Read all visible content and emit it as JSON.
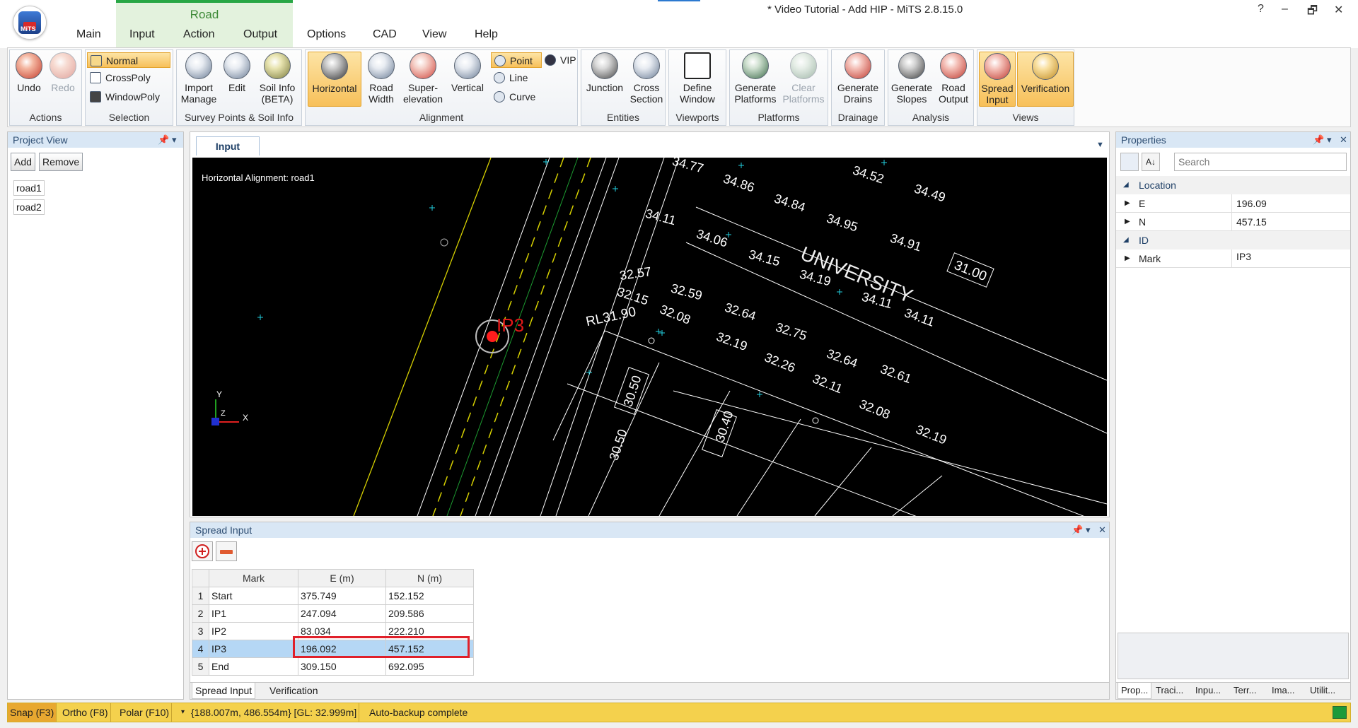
{
  "window": {
    "title": "* Video Tutorial - Add HIP - MiTS 2.8.15.0",
    "help": "?",
    "minimize": "–",
    "restore": "🗗",
    "close": "✕"
  },
  "tabs": {
    "context": "Road",
    "items": [
      "Main",
      "Input",
      "Action",
      "Output",
      "Options",
      "CAD",
      "View",
      "Help"
    ]
  },
  "ribbon": {
    "actions": {
      "label": "Actions",
      "undo": "Undo",
      "redo": "Redo"
    },
    "selection": {
      "label": "Selection",
      "normal": "Normal",
      "crosspoly": "CrossPoly",
      "windowpoly": "WindowPoly"
    },
    "survey": {
      "label": "Survey Points & Soil Info",
      "import_l1": "Import",
      "import_l2": "Manage",
      "edit": "Edit",
      "soil_l1": "Soil Info",
      "soil_l2": "(BETA)"
    },
    "alignment": {
      "label": "Alignment",
      "horizontal": "Horizontal",
      "roadwidth_l1": "Road",
      "roadwidth_l2": "Width",
      "super_l1": "Super-",
      "super_l2": "elevation",
      "vertical": "Vertical",
      "point": "Point",
      "line": "Line",
      "curve": "Curve",
      "vip": "VIP"
    },
    "entities": {
      "label": "Entities",
      "junction": "Junction",
      "cross_l1": "Cross",
      "cross_l2": "Section"
    },
    "viewports": {
      "label": "Viewports",
      "define_l1": "Define",
      "define_l2": "Window"
    },
    "platforms": {
      "label": "Platforms",
      "gen_l1": "Generate",
      "gen_l2": "Platforms",
      "clear_l1": "Clear",
      "clear_l2": "Platforms"
    },
    "drainage": {
      "label": "Drainage",
      "gen_l1": "Generate",
      "gen_l2": "Drains"
    },
    "analysis": {
      "label": "Analysis",
      "slopes_l1": "Generate",
      "slopes_l2": "Slopes",
      "road_l1": "Road",
      "road_l2": "Output"
    },
    "views": {
      "label": "Views",
      "spread_l1": "Spread",
      "spread_l2": "Input",
      "verification": "Verification"
    }
  },
  "project": {
    "title": "Project View",
    "add": "Add",
    "remove": "Remove",
    "items": [
      "road1",
      "road2"
    ]
  },
  "document": {
    "tab": "Input",
    "canvas_title": "Horizontal Alignment: road1",
    "axis_y": "Y",
    "axis_x": "X",
    "axis_z": "Z",
    "ip_label": "IP3",
    "rl_label": "RL31.90",
    "university": "UNIVERSITY",
    "lot_label": "31.00",
    "spot_levels": [
      "34.77",
      "34.86",
      "34.84",
      "34.52",
      "34.49",
      "34.11",
      "34.06",
      "34.95",
      "34.91",
      "34.15",
      "32.57",
      "32.59",
      "34.19",
      "34.11",
      "32.15",
      "32.08",
      "32.64",
      "32.75",
      "34.11",
      "32.19",
      "32.64",
      "32.26",
      "32.61",
      "32.11",
      "32.08",
      "32.19",
      "30.50",
      "30.40",
      "30.50"
    ]
  },
  "spread": {
    "title": "Spread Input",
    "headers": [
      "Mark",
      "E (m)",
      "N (m)"
    ],
    "rows": [
      [
        "1",
        "Start",
        "375.749",
        "152.152"
      ],
      [
        "2",
        "IP1",
        "247.094",
        "209.586"
      ],
      [
        "3",
        "IP2",
        "83.034",
        "222.210"
      ],
      [
        "4",
        "IP3",
        "196.092",
        "457.152"
      ],
      [
        "5",
        "End",
        "309.150",
        "692.095"
      ]
    ],
    "tab_spread": "Spread Input",
    "tab_verification": "Verification"
  },
  "properties": {
    "title": "Properties",
    "search_placeholder": "Search",
    "cat_location": "Location",
    "e_label": "E",
    "e_value": "196.09",
    "n_label": "N",
    "n_value": "457.15",
    "cat_id": "ID",
    "mark_label": "Mark",
    "mark_value": "IP3",
    "bottom_tabs": [
      "Prop...",
      "Traci...",
      "Inpu...",
      "Terr...",
      "Ima...",
      "Utilit..."
    ]
  },
  "status": {
    "snap": "Snap (F3)",
    "ortho": "Ortho (F8)",
    "polar": "Polar (F10)",
    "coords": "{188.007m, 486.554m} [GL: 32.999m]",
    "message": "Auto-backup complete"
  },
  "colors": {
    "accent": "#f7c05a",
    "selected_row": "#b5d7f5",
    "highlight_box": "#e0202a",
    "status": "#f4d14d",
    "canvas": "#000000"
  }
}
